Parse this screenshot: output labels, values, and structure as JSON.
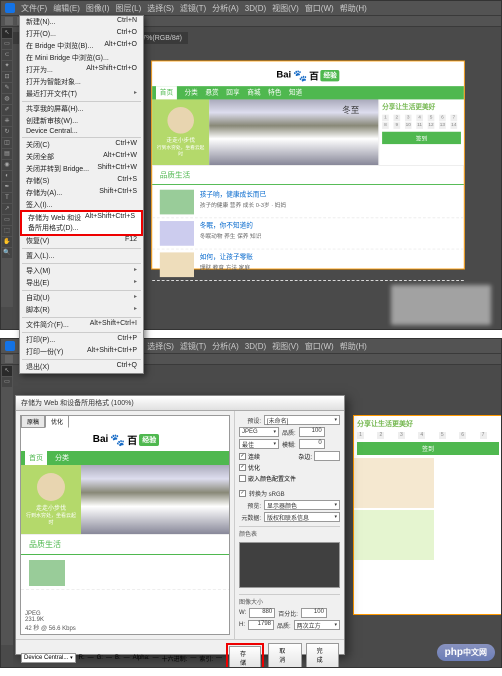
{
  "menubar": [
    "文件(F)",
    "编辑(E)",
    "图像(I)",
    "图层(L)",
    "选择(S)",
    "滤镜(T)",
    "分析(A)",
    "3D(D)",
    "视图(V)",
    "窗口(W)",
    "帮助(H)"
  ],
  "file_menu": [
    {
      "label": "新建(N)...",
      "sc": "Ctrl+N"
    },
    {
      "label": "打开(O)...",
      "sc": "Ctrl+O"
    },
    {
      "label": "在 Bridge 中浏览(B)...",
      "sc": "Alt+Ctrl+O"
    },
    {
      "label": "在 Mini Bridge 中浏览(G)...",
      "sc": ""
    },
    {
      "label": "打开为...",
      "sc": "Alt+Shift+Ctrl+O"
    },
    {
      "label": "打开为智能对象...",
      "sc": ""
    },
    {
      "label": "最近打开文件(T)",
      "sc": "",
      "sub": true
    },
    {
      "sep": true
    },
    {
      "label": "共享我的屏幕(H)...",
      "sc": ""
    },
    {
      "label": "创建新审核(W)...",
      "sc": ""
    },
    {
      "label": "Device Central...",
      "sc": ""
    },
    {
      "sep": true
    },
    {
      "label": "关闭(C)",
      "sc": "Ctrl+W"
    },
    {
      "label": "关闭全部",
      "sc": "Alt+Ctrl+W"
    },
    {
      "label": "关闭并转到 Bridge...",
      "sc": "Shift+Ctrl+W"
    },
    {
      "label": "存储(S)",
      "sc": "Ctrl+S"
    },
    {
      "label": "存储为(A)...",
      "sc": "Shift+Ctrl+S"
    },
    {
      "label": "签入(I)...",
      "sc": ""
    },
    {
      "label": "存储为 Web 和设备所用格式(D)...",
      "sc": "Alt+Shift+Ctrl+S",
      "hl": true
    },
    {
      "label": "恢复(V)",
      "sc": "F12"
    },
    {
      "sep": true
    },
    {
      "label": "置入(L)...",
      "sc": ""
    },
    {
      "sep": true
    },
    {
      "label": "导入(M)",
      "sc": "",
      "sub": true
    },
    {
      "label": "导出(E)",
      "sc": "",
      "sub": true
    },
    {
      "sep": true
    },
    {
      "label": "自动(U)",
      "sc": "",
      "sub": true
    },
    {
      "label": "脚本(R)",
      "sc": "",
      "sub": true
    },
    {
      "sep": true
    },
    {
      "label": "文件简介(F)...",
      "sc": "Alt+Shift+Ctrl+I"
    },
    {
      "sep": true
    },
    {
      "label": "打印(P)...",
      "sc": "Ctrl+P"
    },
    {
      "label": "打印一份(Y)",
      "sc": "Alt+Shift+Ctrl+P"
    },
    {
      "sep": true
    },
    {
      "label": "退出(X)",
      "sc": "Ctrl+Q"
    }
  ],
  "doc_tab": "标签880020150960~0244_付.jpg @ 66.7%(RGB/8#)",
  "baidu": {
    "name": "Bai",
    "du": "百",
    "exp": "经验"
  },
  "nav": [
    "首页",
    "分类",
    "悬赏",
    "回享",
    "商城",
    "特色",
    "知道"
  ],
  "hero_text": "冬至",
  "avatar_name": "走走小步伐",
  "avatar_quote": "行到水穷处，坐看云起时",
  "section_title": "品质生活",
  "promo_text": "分享让生活更美好",
  "signin": "签到",
  "articles": [
    {
      "title": "孩子响，健康成长而已",
      "sub": "孩子的健康 营养 成长 0-3岁 · 妈妈"
    },
    {
      "title": "冬眠，你不知道的",
      "sub": "冬眠动物 养生 保养 知识"
    },
    {
      "title": "如何，让孩子零账",
      "sub": "理财 教育 方法 家庭"
    }
  ],
  "sfw": {
    "title": "存储为 Web 和设备所用格式 (100%)",
    "tabs": [
      "原稿",
      "优化"
    ],
    "preset": "预设:",
    "preset_val": "[未命名]",
    "format": "JPEG",
    "quality_label": "品质:",
    "quality_val": "100",
    "quality_level": "最佳",
    "progressive": "连续",
    "blur_label": "模糊:",
    "blur_val": "0",
    "optimized": "优化",
    "matte_label": "杂边:",
    "embed_profile": "嵌入颜色配置文件",
    "convert_srgb": "转换为 sRGB",
    "preview_label": "预览:",
    "preview_val": "显示器颜色",
    "metadata_label": "元数据:",
    "metadata_val": "版权和联系信息",
    "color_table": "颜色表",
    "image_size": "图像大小",
    "w_label": "W:",
    "w_val": "880",
    "h_label": "H:",
    "h_val": "1798",
    "percent": "百分比:",
    "percent_val": "100",
    "quality2": "品质:",
    "quality2_val": "两次立方",
    "info_format": "JPEG",
    "info_size": "231.9K",
    "info_time": "42 秒 @ 56.6 Kbps",
    "footer_device": "Device Central...",
    "footer_r": "R:",
    "footer_g": "G:",
    "footer_b": "B:",
    "footer_alpha": "Alpha:",
    "footer_hex": "十六进制:",
    "footer_idx": "索引:",
    "btn_save": "存储",
    "btn_cancel": "取消",
    "btn_done": "完成"
  },
  "watermark": {
    "php": "php",
    "cn": "中文网"
  }
}
